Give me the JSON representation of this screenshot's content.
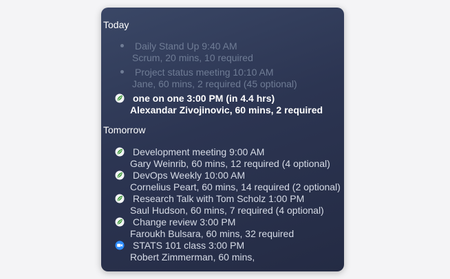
{
  "today": {
    "title": "Today",
    "events": [
      {
        "title": "Daily Stand Up 9:40 AM",
        "details": "Scrum, 20 mins, 10 required",
        "status": "past",
        "icon": "bullet"
      },
      {
        "title": "Project status meeting 10:10 AM",
        "details": "Jane, 60 mins, 2 required (45 optional)",
        "status": "past",
        "icon": "bullet"
      },
      {
        "title": "one on one 3:00 PM (in 4.4 hrs)",
        "details": "Alexandar Zivojinovic, 60 mins, 2 required",
        "status": "current",
        "icon": "calendar-leaf-icon"
      }
    ]
  },
  "tomorrow": {
    "title": "Tomorrow",
    "events": [
      {
        "title": "Development meeting 9:00 AM",
        "details": "Gary Weinrib, 60 mins, 12 required (4 optional)",
        "status": "future",
        "icon": "calendar-leaf-icon"
      },
      {
        "title": "DevOps Weekly 10:00 AM",
        "details": "Cornelius Peart, 60 mins, 14 required (2 optional)",
        "status": "future",
        "icon": "calendar-leaf-icon"
      },
      {
        "title": "Research Talk with Tom Scholz 1:00 PM",
        "details": "Saul Hudson, 60 mins, 7 required (4 optional)",
        "status": "future",
        "icon": "calendar-leaf-icon"
      },
      {
        "title": "Change review 3:00 PM",
        "details": "Faroukh Bulsara, 60 mins, 32 required",
        "status": "future",
        "icon": "calendar-leaf-icon"
      },
      {
        "title": "STATS 101 class 3:00 PM",
        "details": "Robert Zimmerman, 60 mins,",
        "status": "future",
        "icon": "video-camera-icon"
      }
    ]
  }
}
